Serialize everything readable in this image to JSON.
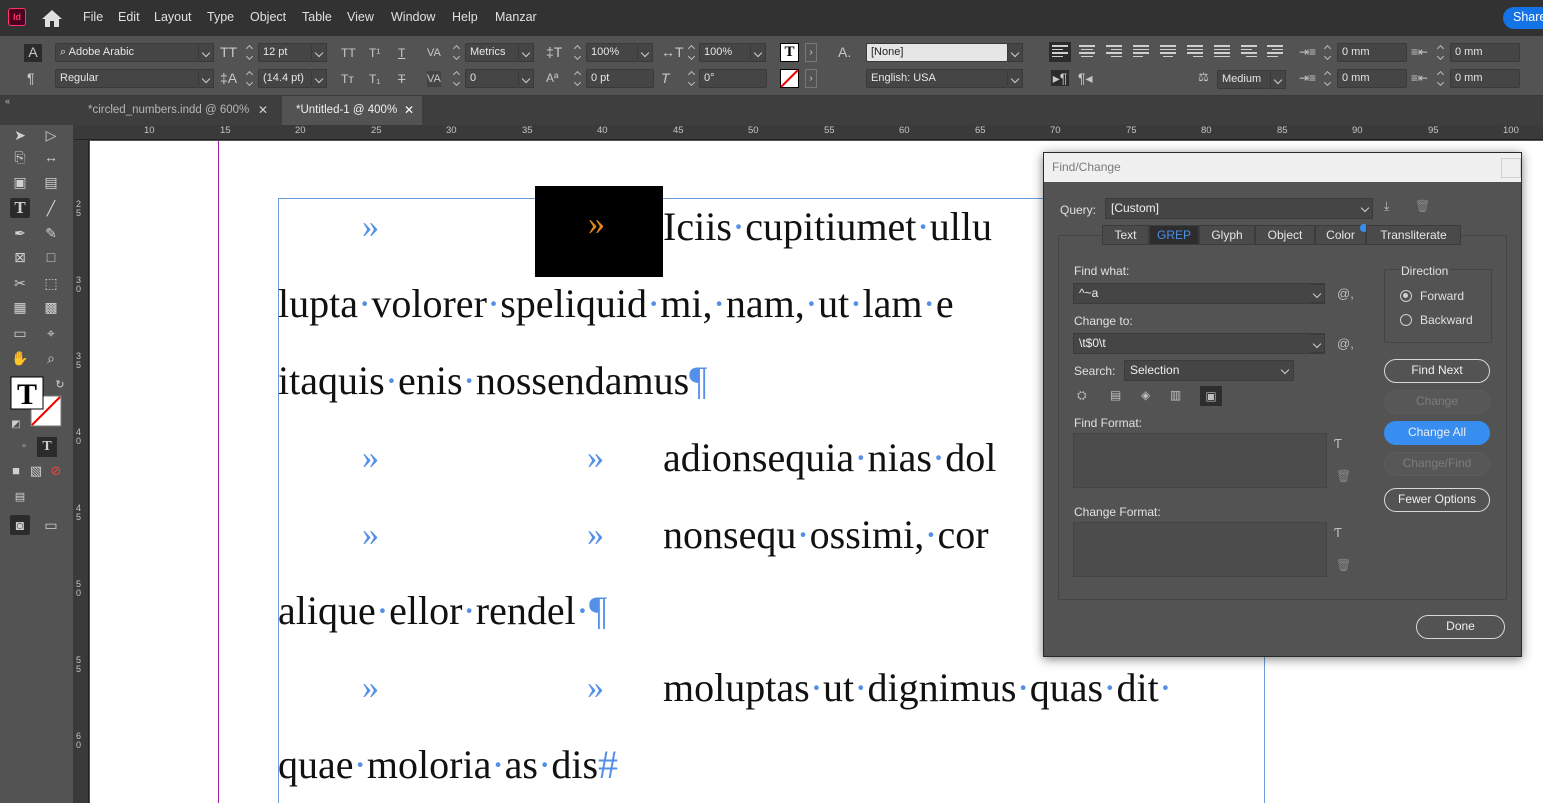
{
  "app": {
    "logo_text": "Id"
  },
  "menu": [
    "File",
    "Edit",
    "Layout",
    "Type",
    "Object",
    "Table",
    "View",
    "Window",
    "Help",
    "Manzar"
  ],
  "share_label": "Share",
  "control_bar": {
    "font_family": "Adobe Arabic",
    "font_style": "Regular",
    "font_size": "12 pt",
    "leading": "(14.4 pt)",
    "kerning": "Metrics",
    "tracking": "0",
    "vertical_scale": "100%",
    "horizontal_scale": "100%",
    "baseline_shift": "0 pt",
    "skew": "0°",
    "char_style": "[None]",
    "language": "English: USA",
    "hyphenation": "Medium",
    "left_indent": "0 mm",
    "right_indent": "0 mm",
    "first_indent": "0 mm",
    "last_indent": "0 mm"
  },
  "tabs": [
    {
      "label": "*circled_numbers.indd @ 600%",
      "active": false
    },
    {
      "label": "*Untitled-1 @ 400%",
      "active": true
    }
  ],
  "ruler": {
    "horizontal": [
      "10",
      "15",
      "20",
      "25",
      "30",
      "35",
      "40",
      "45",
      "50",
      "55",
      "60",
      "65",
      "70",
      "75",
      "80",
      "85",
      "90",
      "95",
      "100"
    ],
    "vertical": [
      "25",
      "30",
      "35",
      "40",
      "45",
      "50",
      "55",
      "60"
    ]
  },
  "document": {
    "lines": [
      "Iciis·cupitiumet·ullu",
      "lupta·volorer·speliquid·mi,·nam,·ut·lam·e",
      "itaquis·enis·nossendamus",
      "adionsequia·nias·dol",
      "nonsequ·ossimi,·cor",
      "alique·ellor·rendel·",
      "moluptas·ut·dignimus·quas·dit·",
      "quae·moloria·as·dis"
    ],
    "tab_glyph": "»",
    "paragraph_mark": "¶",
    "end_mark": "#"
  },
  "dialog": {
    "title": "Find/Change",
    "query_label": "Query:",
    "query_value": "[Custom]",
    "tabs": [
      "Text",
      "GREP",
      "Glyph",
      "Object",
      "Color",
      "Transliterate"
    ],
    "active_tab": "GREP",
    "find_what_label": "Find what:",
    "find_what_value": "^~a",
    "change_to_label": "Change to:",
    "change_to_value": "\\t$0\\t",
    "search_label": "Search:",
    "search_value": "Selection",
    "find_format_label": "Find Format:",
    "change_format_label": "Change Format:",
    "direction_label": "Direction",
    "forward_label": "Forward",
    "backward_label": "Backward",
    "direction_selected": "Forward",
    "buttons": {
      "find_next": "Find Next",
      "change": "Change",
      "change_all": "Change All",
      "change_find": "Change/Find",
      "fewer_options": "Fewer Options",
      "done": "Done"
    }
  },
  "colors": {
    "accent": "#378ef0",
    "hidden_chars": "#5590e8",
    "selection_glyph": "#e08a1e"
  }
}
